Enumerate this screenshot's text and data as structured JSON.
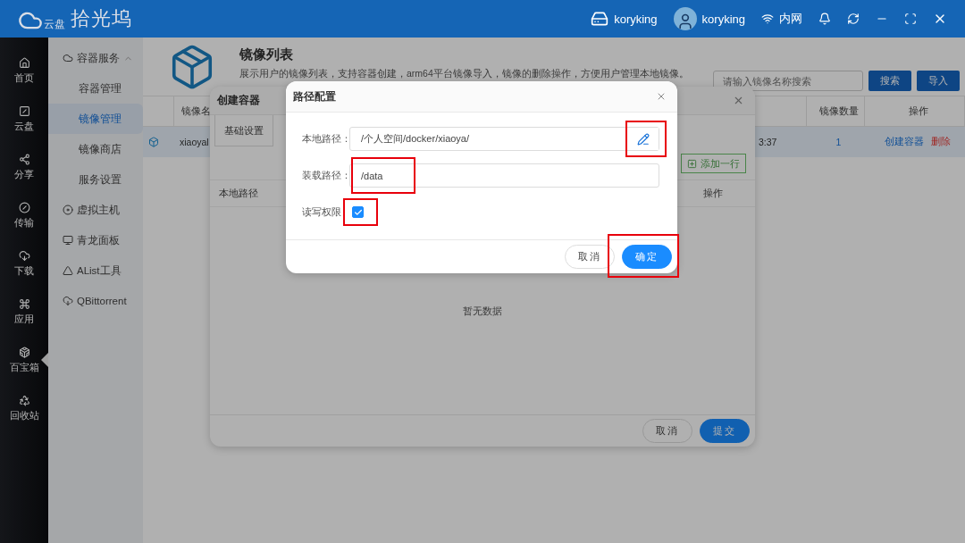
{
  "topbar": {
    "logo_badge": "云盘",
    "app_name": "拾光坞",
    "device": "koryking",
    "user": "koryking",
    "network": "内网"
  },
  "nav": [
    {
      "label": "首页",
      "selected": false
    },
    {
      "label": "云盘",
      "selected": false
    },
    {
      "label": "分享",
      "selected": false
    },
    {
      "label": "传输",
      "selected": false
    },
    {
      "label": "下载",
      "selected": false
    },
    {
      "label": "应用",
      "selected": false
    },
    {
      "label": "百宝箱",
      "selected": true
    },
    {
      "label": "回收站",
      "selected": false
    }
  ],
  "subnav": [
    {
      "kind": "group",
      "label": "容器服务",
      "expanded": true,
      "children": [
        {
          "label": "容器管理",
          "selected": false
        },
        {
          "label": "镜像管理",
          "selected": true
        },
        {
          "label": "镜像商店",
          "selected": false
        },
        {
          "label": "服务设置",
          "selected": false
        }
      ]
    },
    {
      "kind": "link",
      "label": "虚拟主机"
    },
    {
      "kind": "link",
      "label": "青龙面板"
    },
    {
      "kind": "link",
      "label": "AList工具"
    },
    {
      "kind": "link",
      "label": "QBittorrent"
    }
  ],
  "page": {
    "title": "镜像列表",
    "description": "展示用户的镜像列表，支持容器创建，arm64平台镜像导入，镜像的删除操作，方便用户管理本地镜像。",
    "search": {
      "placeholder": "请输入镜像名称搜索"
    },
    "buttons": [
      "搜索",
      "导入"
    ]
  },
  "table": {
    "columns": {
      "name": "镜像名",
      "count": "镜像数量",
      "actions": "操作"
    },
    "rows": [
      {
        "name": "xiaoyal",
        "time": "3:37",
        "count": "1",
        "selected": true,
        "actions": [
          {
            "label": "创建容器",
            "kind": "link"
          },
          {
            "label": "删除",
            "kind": "danger"
          }
        ]
      }
    ]
  },
  "create_dialog": {
    "title": "创建容器",
    "tabs": [
      {
        "label": "基础设置",
        "selected": true
      }
    ],
    "add_button": "添加一行",
    "columns": [
      "本地路径",
      "操作"
    ],
    "empty_text": "暂无数据",
    "buttons": [
      {
        "label": "取消",
        "kind": "secondary"
      },
      {
        "label": "提交",
        "kind": "primary"
      }
    ]
  },
  "path_dialog": {
    "title": "路径配置",
    "fields": [
      {
        "kind": "picker",
        "label": "本地路径：",
        "value": "/个人空间/docker/xiaoya/",
        "highlighted": true
      },
      {
        "kind": "input",
        "label": "装载路径：",
        "value": "/data",
        "highlighted": true
      },
      {
        "kind": "checkbox",
        "label": "读写权限",
        "checked": true,
        "highlighted": true
      }
    ],
    "buttons": [
      {
        "label": "取消",
        "kind": "secondary",
        "highlighted": false
      },
      {
        "label": "确定",
        "kind": "primary",
        "highlighted": true
      }
    ]
  }
}
